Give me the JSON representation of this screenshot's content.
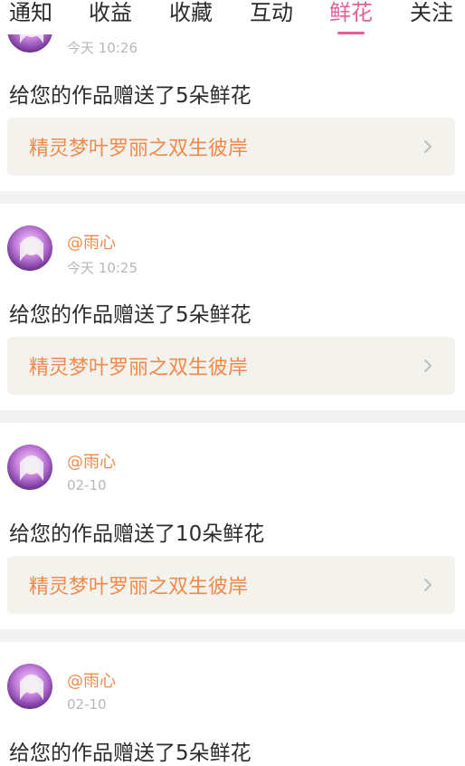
{
  "tabs": [
    {
      "label": "通知",
      "active": false
    },
    {
      "label": "收益",
      "active": false
    },
    {
      "label": "收藏",
      "active": false
    },
    {
      "label": "互动",
      "active": false
    },
    {
      "label": "鲜花",
      "active": true
    },
    {
      "label": "关注",
      "active": false
    }
  ],
  "colors": {
    "accent_pink": "#e0609a",
    "username_orange": "#f08a4b",
    "work_box_bg": "#f3f2ed",
    "separator_gray": "#f3f3f3"
  },
  "feed": [
    {
      "username": "",
      "time": "今天 10:26",
      "message": "给您的作品赠送了5朵鲜花",
      "work_title": "精灵梦叶罗丽之双生彼岸",
      "avatar_icon": "anime-avatar"
    },
    {
      "username": "@雨心",
      "time": "今天 10:25",
      "message": "给您的作品赠送了5朵鲜花",
      "work_title": "精灵梦叶罗丽之双生彼岸",
      "avatar_icon": "anime-avatar"
    },
    {
      "username": "@雨心",
      "time": "02-10",
      "message": "给您的作品赠送了10朵鲜花",
      "work_title": "精灵梦叶罗丽之双生彼岸",
      "avatar_icon": "anime-avatar"
    },
    {
      "username": "@雨心",
      "time": "02-10",
      "message": "给您的作品赠送了5朵鲜花",
      "work_title": "",
      "avatar_icon": "anime-avatar"
    }
  ]
}
